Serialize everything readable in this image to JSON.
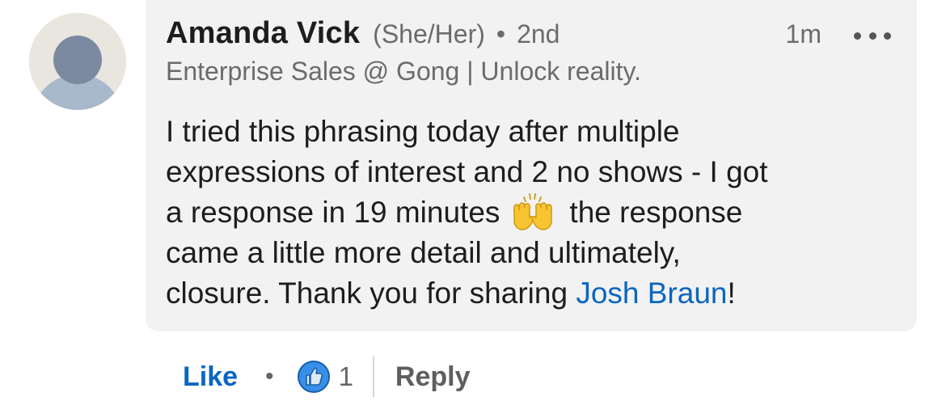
{
  "comment": {
    "author": {
      "name": "Amanda Vick",
      "pronouns": "(She/Her)",
      "separator": "•",
      "degree": "2nd",
      "headline": "Enterprise Sales @ Gong | Unlock reality.",
      "avatar_icon": "default-person-avatar-icon"
    },
    "time": "1m",
    "more_icon": "more-options-icon",
    "text": {
      "line1": "I tried this phrasing today after multiple",
      "line2": "expressions of interest and 2 no shows - I got",
      "line3_before": "a response in 19 minutes",
      "emoji_icon": "raising-hands-icon",
      "line3_after": "the response",
      "line4": "came a little more detail and ultimately,",
      "line5_before": "closure. Thank you for sharing ",
      "mention": "Josh Braun",
      "line5_after": "!"
    }
  },
  "actions": {
    "like_label": "Like",
    "separator": "•",
    "reaction_icon": "like-reaction-icon",
    "reaction_count": "1",
    "reply_label": "Reply"
  },
  "colors": {
    "link_blue": "#0a66c2",
    "bubble_bg": "#f2f2f2",
    "muted_text": "#6b6b6b"
  }
}
